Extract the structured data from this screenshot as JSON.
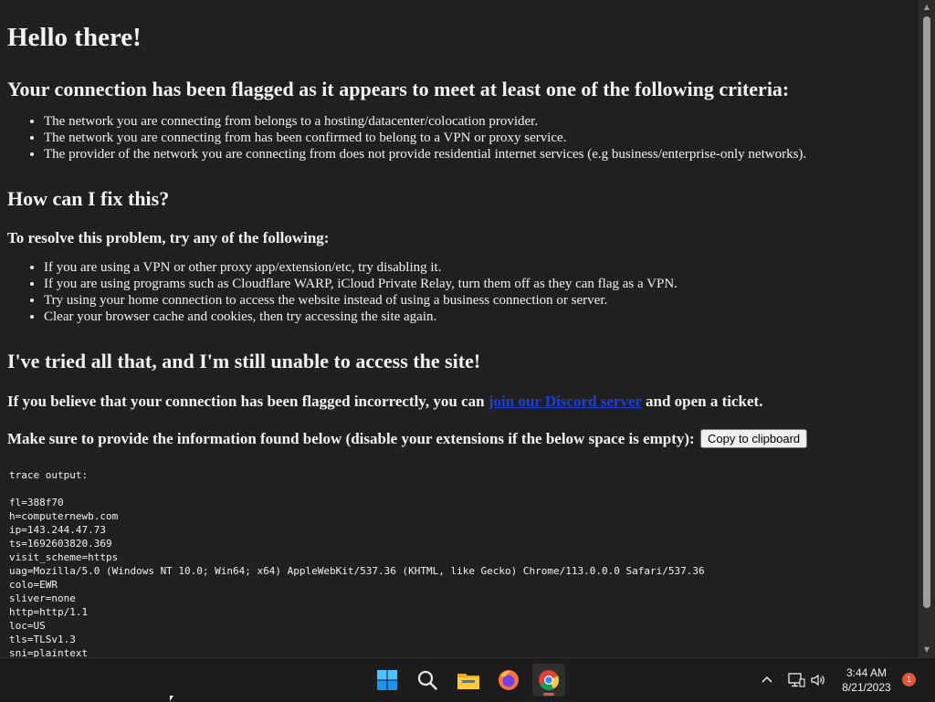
{
  "page": {
    "title": "Hello there!",
    "criteria_heading": "Your connection has been flagged as it appears to meet at least one of the following criteria:",
    "criteria": [
      "The network you are connecting from belongs to a hosting/datacenter/colocation provider.",
      "The network you are connecting from has been confirmed to belong to a VPN or proxy service.",
      "The provider of the network you are connecting from does not provide residential internet services (e.g business/enterprise-only networks)."
    ],
    "fix_heading": "How can I fix this?",
    "resolve_heading": "To resolve this problem, try any of the following:",
    "fixes": [
      "If you are using a VPN or other proxy app/extension/etc, try disabling it.",
      "If you are using programs such as Cloudflare WARP, iCloud Private Relay, turn them off as they can flag as a VPN.",
      "Try using your home connection to access the website instead of using a business connection or server.",
      "Clear your browser cache and cookies, then try accessing the site again."
    ],
    "tried_heading": "I've tried all that, and I'm still unable to access the site!",
    "incorrect_prefix": "If you believe that your connection has been flagged incorrectly, you can ",
    "discord_link": "join our Discord server",
    "incorrect_suffix": " and open a ticket.",
    "provide_info": "Make sure to provide the information found below (disable your extensions if the below space is empty):",
    "copy_button": "Copy to clipboard",
    "trace": "trace output:\n\nfl=388f70\nh=computernewb.com\nip=143.244.47.73\nts=1692603820.369\nvisit_scheme=https\nuag=Mozilla/5.0 (Windows NT 10.0; Win64; x64) AppleWebKit/537.36 (KHTML, like Gecko) Chrome/113.0.0.0 Safari/537.36\ncolo=EWR\nsliver=none\nhttp=http/1.1\nloc=US\ntls=TLSv1.3\nsni=plaintext"
  },
  "taskbar": {
    "icons": [
      "windows-start-icon",
      "search-icon",
      "file-explorer-icon",
      "firefox-icon",
      "chrome-icon"
    ],
    "time": "3:44 AM",
    "date": "8/21/2023",
    "notification_count": "1",
    "colors": {
      "background": "#1c1c1c",
      "accent": "#e0553c"
    }
  }
}
